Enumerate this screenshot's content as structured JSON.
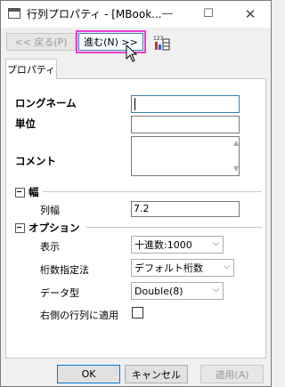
{
  "window": {
    "title": "行列プロパティ - [MBook...",
    "minimize": "—",
    "maximize": "☐",
    "close": "✕"
  },
  "nav": {
    "back": "<< 戻る(P)",
    "next": "進む(N) >>",
    "numeric_icon_text": "123"
  },
  "tabs": [
    {
      "label": "プロパティ"
    }
  ],
  "fields": {
    "long_name": {
      "label": "ロングネーム",
      "value": ""
    },
    "unit": {
      "label": "単位",
      "value": ""
    },
    "comment": {
      "label": "コメント",
      "value": ""
    }
  },
  "width_section": {
    "title": "幅",
    "column_width_label": "列幅",
    "column_width_value": "7.2"
  },
  "options_section": {
    "title": "オプション",
    "display": {
      "label": "表示",
      "value": "十進数:1000"
    },
    "digits": {
      "label": "桁数指定法",
      "value": "デフォルト桁数"
    },
    "data_type": {
      "label": "データ型",
      "value": "Double(8)"
    },
    "apply_right": {
      "label": "右側の行列に適用",
      "checked": false
    }
  },
  "buttons": {
    "ok": "OK",
    "cancel": "キャンセル",
    "apply": "適用(A)"
  },
  "colors": {
    "highlight": "#ee3ccf",
    "focus_border": "#3c7fb1"
  }
}
